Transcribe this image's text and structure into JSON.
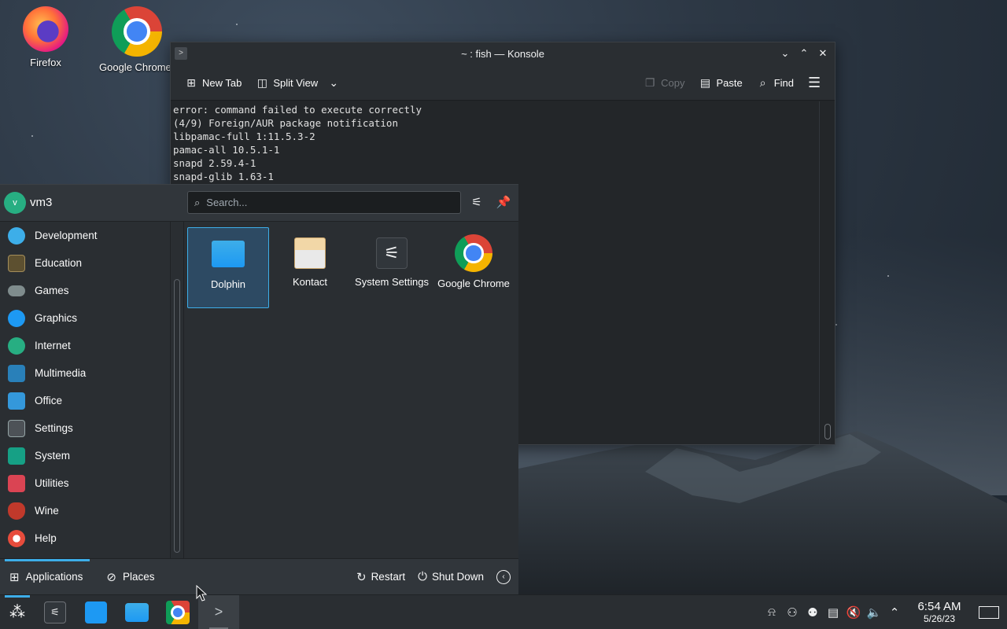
{
  "desktop": {
    "icons": [
      {
        "label": "Firefox"
      },
      {
        "label": "Google Chrome"
      }
    ]
  },
  "konsole": {
    "title": "~ : fish — Konsole",
    "toolbar": {
      "new_tab": "New Tab",
      "split_view": "Split View",
      "copy": "Copy",
      "paste": "Paste",
      "find": "Find"
    },
    "terminal_lines": [
      "error: command failed to execute correctly",
      "(4/9) Foreign/AUR package notification",
      "libpamac-full 1:11.5.3-2",
      "pamac-all 10.5.1-1",
      "snapd 2.59.4-1",
      "snapd-glib 1.63-1"
    ]
  },
  "launcher": {
    "avatar_initial": "v",
    "username": "vm3",
    "search_placeholder": "Search...",
    "categories": [
      {
        "label": "Development",
        "color": "#3daee9"
      },
      {
        "label": "Education",
        "color": "#8d7a4a"
      },
      {
        "label": "Games",
        "color": "#7f8c8d"
      },
      {
        "label": "Graphics",
        "color": "#1d99f3"
      },
      {
        "label": "Internet",
        "color": "#27ae82"
      },
      {
        "label": "Multimedia",
        "color": "#2980b9"
      },
      {
        "label": "Office",
        "color": "#3498db"
      },
      {
        "label": "Settings",
        "color": "#95a5a6"
      },
      {
        "label": "System",
        "color": "#16a085"
      },
      {
        "label": "Utilities",
        "color": "#da4453"
      },
      {
        "label": "Wine",
        "color": "#c0392b"
      },
      {
        "label": "Help",
        "color": "#e74c3c"
      }
    ],
    "apps": [
      {
        "label": "Dolphin",
        "selected": true
      },
      {
        "label": "Kontact",
        "selected": false
      },
      {
        "label": "System Settings",
        "selected": false
      },
      {
        "label": "Google Chrome",
        "selected": false
      }
    ],
    "footer": {
      "applications": "Applications",
      "places": "Places",
      "restart": "Restart",
      "shutdown": "Shut Down"
    }
  },
  "taskbar": {
    "clock_time": "6:54 AM",
    "clock_date": "5/26/23"
  },
  "colors": {
    "accent": "#3daee9",
    "panel": "#2a2e32",
    "header": "#31363b"
  }
}
